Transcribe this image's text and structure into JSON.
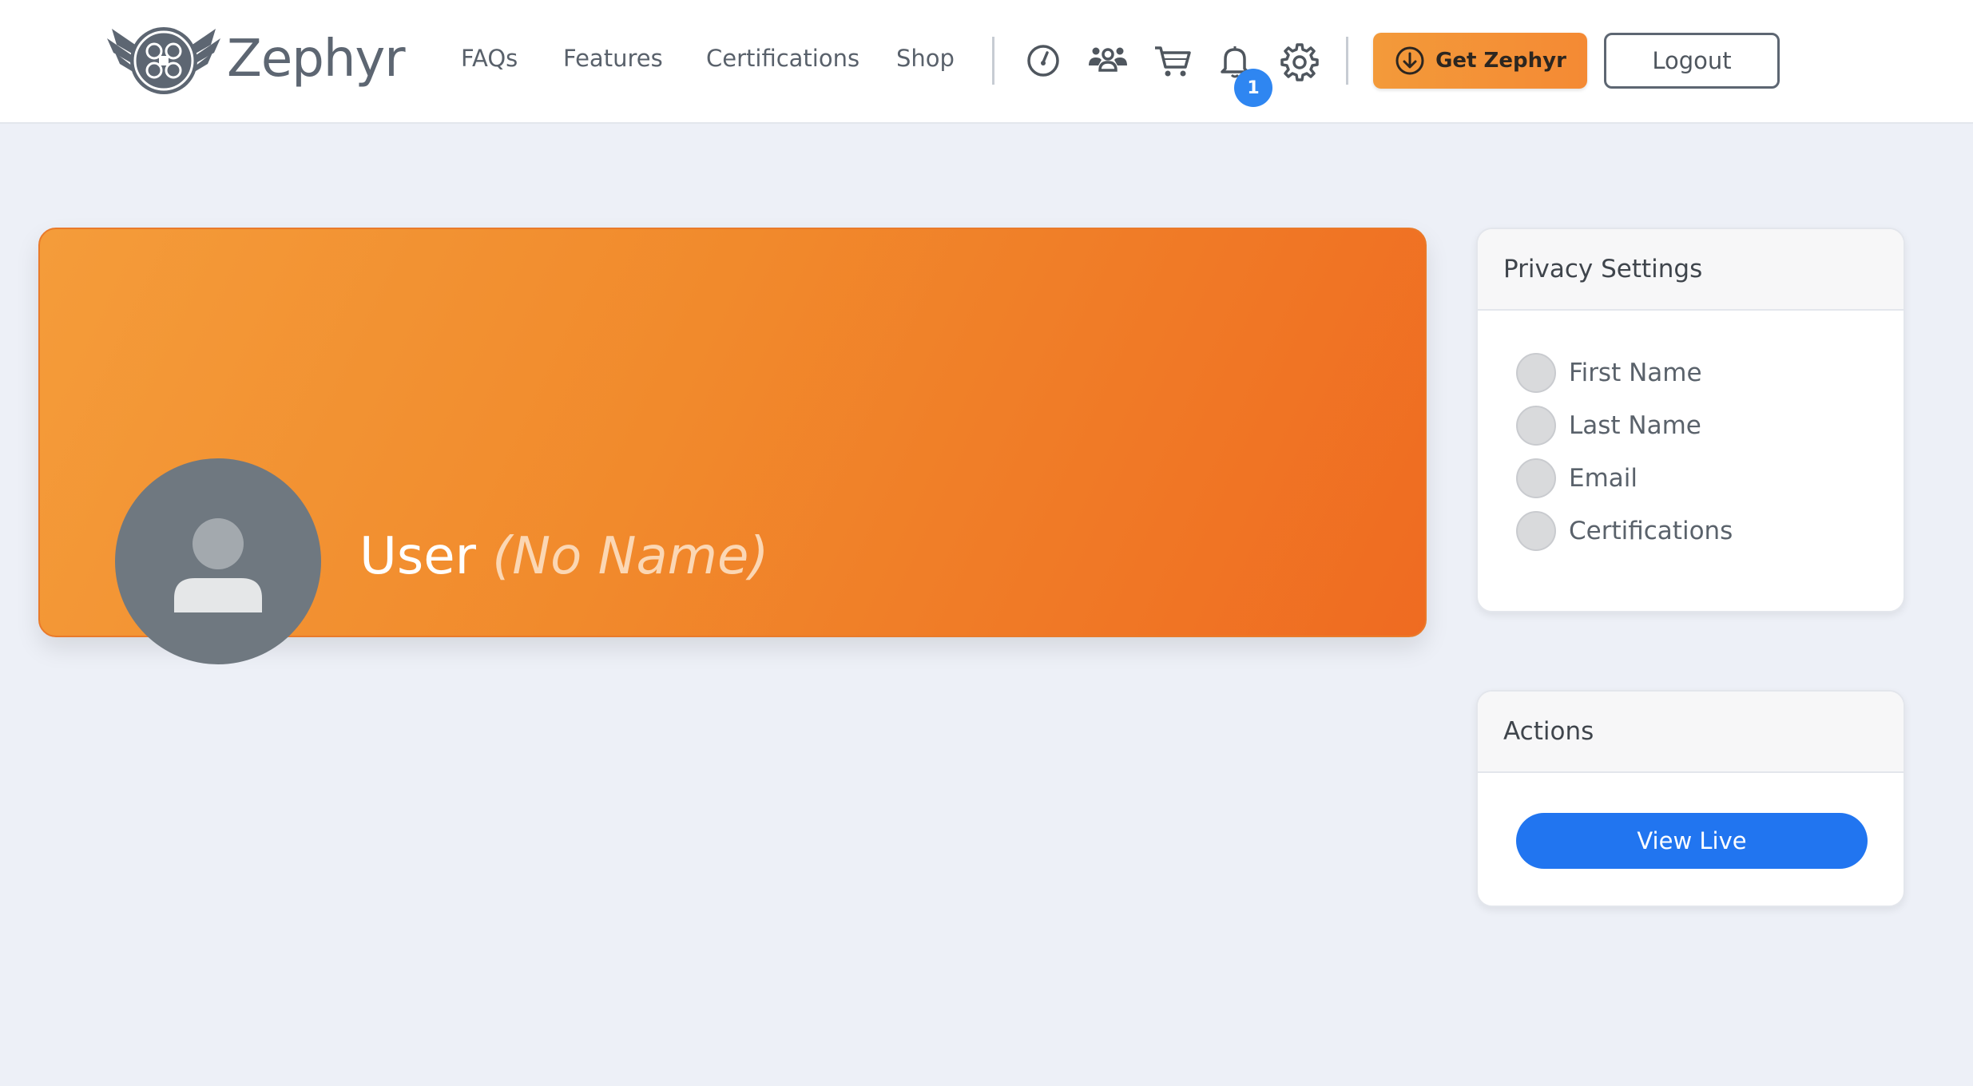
{
  "brand": {
    "name": "Zephyr"
  },
  "nav": {
    "links": [
      "FAQs",
      "Features",
      "Certifications",
      "Shop"
    ],
    "icons": [
      "speedometer-icon",
      "users-icon",
      "cart-icon",
      "bell-icon",
      "gear-icon"
    ],
    "notification_count": "1",
    "get_label": "Get Zephyr",
    "logout_label": "Logout"
  },
  "profile": {
    "label": "User",
    "name_placeholder": "(No Name)"
  },
  "privacy": {
    "title": "Privacy Settings",
    "items": [
      "First Name",
      "Last Name",
      "Email",
      "Certifications"
    ]
  },
  "actions": {
    "title": "Actions",
    "view_live_label": "View Live"
  },
  "colors": {
    "accent_orange": "#f18a2c",
    "primary_blue": "#2175f0",
    "badge_blue": "#2f86f1",
    "page_bg": "#edf0f7"
  }
}
